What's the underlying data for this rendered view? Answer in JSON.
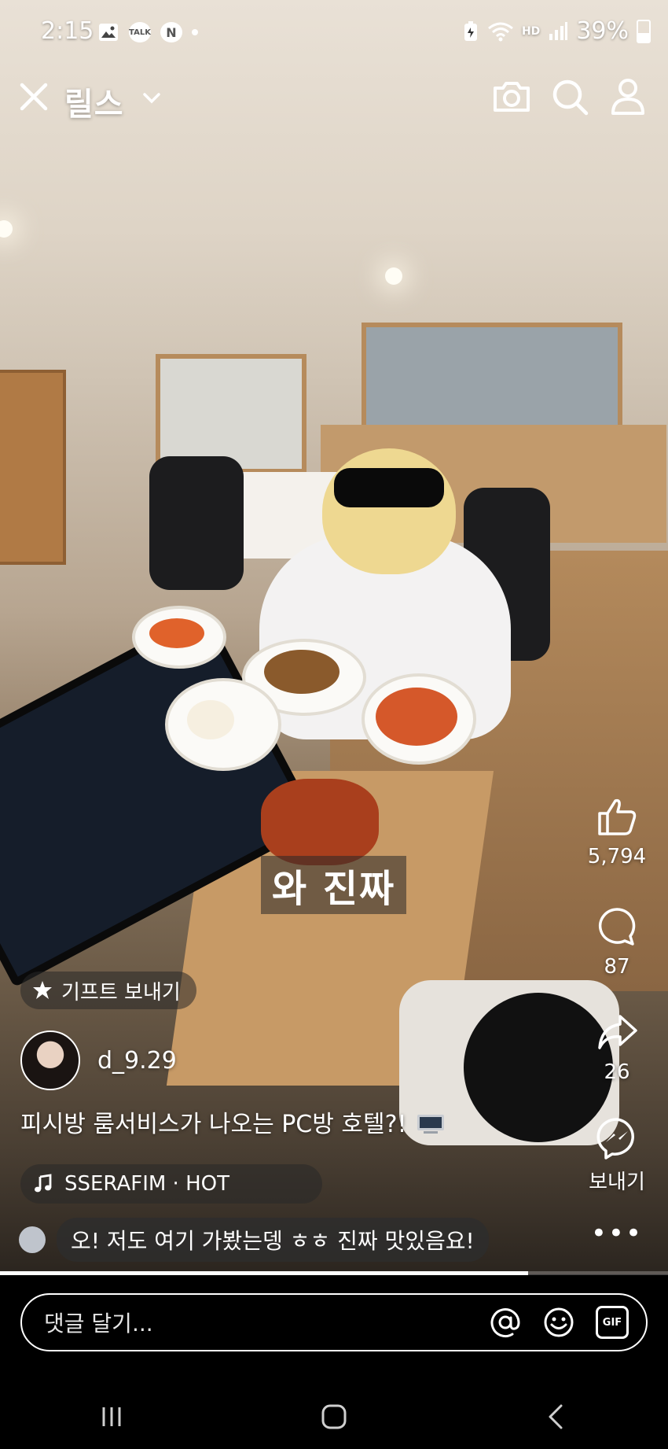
{
  "status_bar": {
    "time": "2:15",
    "left_icons": [
      "gallery-icon",
      "kakaotalk-icon",
      "naver-icon"
    ],
    "talk_label": "TALK",
    "naver_label": "N",
    "hd_label": "HD",
    "battery": "39%"
  },
  "header": {
    "title": "릴스",
    "icons": [
      "camera-icon",
      "search-icon",
      "profile-icon"
    ]
  },
  "video": {
    "subtitle": "와 진짜"
  },
  "rail": {
    "likes": "5,794",
    "comments": "87",
    "shares": "26",
    "send_label": "보내기"
  },
  "gift": {
    "label": "기프트 보내기"
  },
  "user": {
    "username": "d_9.29"
  },
  "caption": "피시방 룸서비스가 나오는 PC방 호텔?!",
  "music": {
    "text": "SSERAFIM · HOT"
  },
  "top_comment": "오! 저도 여기 가봤는뎅 ㅎㅎ 진짜 맛있음요!",
  "progress": {
    "fraction": 0.79
  },
  "comment_box": {
    "placeholder": "댓글 달기...",
    "gif_label": "GIF"
  },
  "navbar": [
    "recent-apps-icon",
    "home-icon",
    "back-icon"
  ]
}
